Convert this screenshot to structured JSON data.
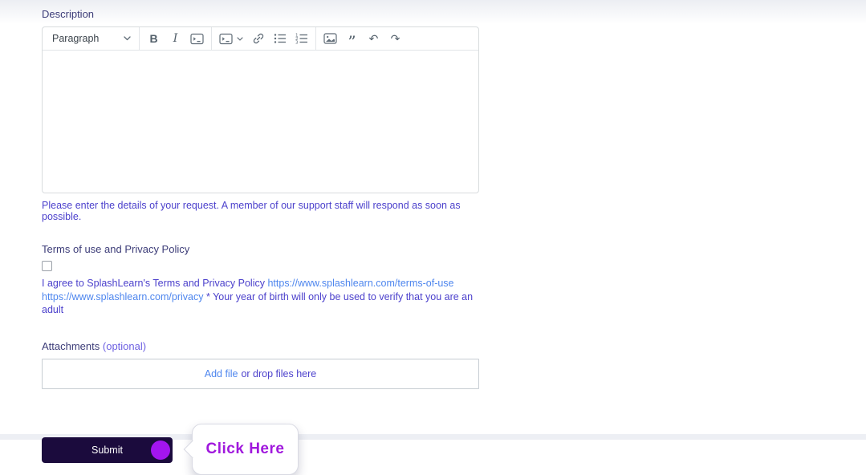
{
  "theme": {
    "label_color": "#3c3c78",
    "body_text_color": "#4c41cc",
    "link_color": "#4e86ee",
    "optional_color": "#6e61e2",
    "button_bg": "#1b0b3d",
    "accent_circle": "#a315ef",
    "callout_text_color": "#a018dd",
    "editor_border": "#d8dcde"
  },
  "description": {
    "label": "Description",
    "helper": "Please enter the details of your request. A member of our support staff will respond as soon as possible."
  },
  "toolbar": {
    "paragraph_label": "Paragraph",
    "icons": {
      "bold": "B",
      "italic": "I",
      "code_span": "code-span-icon",
      "code_block": "code-block-icon",
      "link": "link-icon",
      "bullet_list": "bullet-list-icon",
      "ordered_list": "ordered-list-icon",
      "image": "image-icon",
      "quote": "”",
      "undo": "↶",
      "redo": "↷"
    }
  },
  "terms": {
    "label": "Terms of use and Privacy Policy",
    "agree_prefix": "I agree to SplashLearn's Terms and Privacy Policy",
    "link_terms": "https://www.splashlearn.com/terms-of-use",
    "link_privacy": "https://www.splashlearn.com/privacy",
    "agree_suffix": "* Your year of birth will only be used to verify that you are an adult",
    "checkbox_checked": false
  },
  "attachments": {
    "label": "Attachments",
    "optional_label": "(optional)",
    "add_file_label": "Add file",
    "drop_label": "or drop files here"
  },
  "submit": {
    "label": "Submit"
  },
  "callout": {
    "text": "Click Here"
  }
}
